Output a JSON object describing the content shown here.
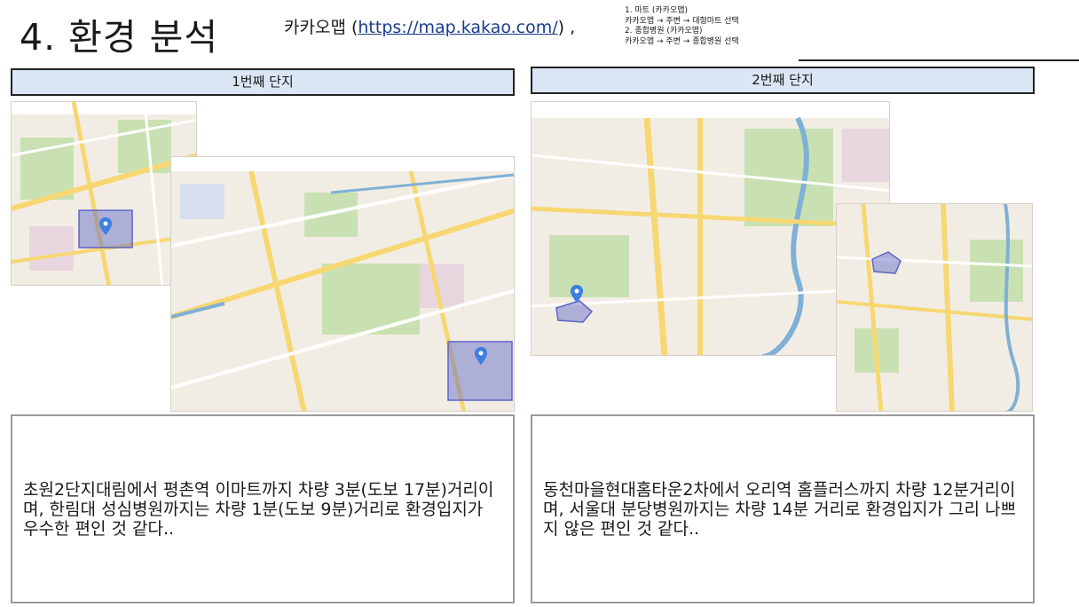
{
  "page_title": "4. 환경 분석",
  "source": {
    "prefix": "카카오맵 (",
    "link": "https://map.kakao.com/",
    "suffix": ") ,"
  },
  "notes": [
    "1. 마트 (카카오맵)",
    "카카오맵 → 주변 → 대형마트 선택",
    "2. 종합병원 (카카오맵)",
    "카카오맵 → 주변 → 종합병원 선택"
  ],
  "panels": [
    {
      "header": "1번째 단지",
      "description": "초원2단지대림에서 평촌역 이마트까지 차량 3분(도보 17분)거리이며, 한림대 성심병원까지는 차량 1분(도보 9분)거리로 환경입지가 우수한 편인 것 같다.."
    },
    {
      "header": "2번째 단지",
      "description": "동천마을현대홈타운2차에서 오리역 홈플러스까지 차량 12분거리이며, 서울대 분당병원까지는 차량 14분 거리로 환경입지가 그리 나쁘지 않은 편인 것 같다.."
    }
  ],
  "colors": {
    "header_bg": "#dbe6f4",
    "map_land": "#f2ede4",
    "map_park": "#c9e1b2",
    "map_road": "#f7d772",
    "map_water": "#7fb0d6",
    "selection": "#5c63c8",
    "marker": "#3d7fe0"
  },
  "icons": [
    "map-marker-icon"
  ]
}
